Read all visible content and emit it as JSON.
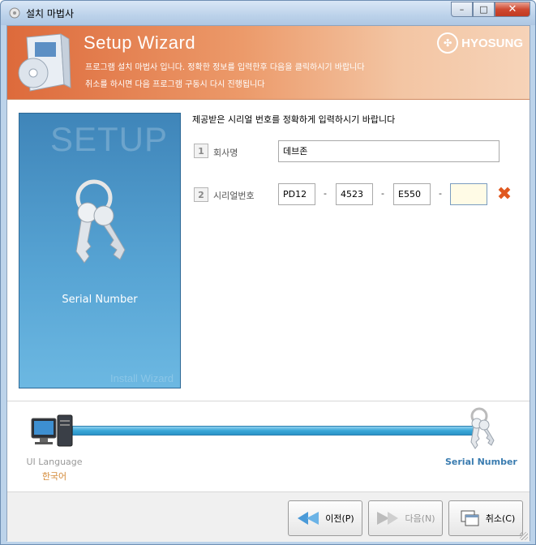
{
  "window": {
    "title": "설치 마법사",
    "minimize_label": "–",
    "maximize_label": "□",
    "close_label": "✕"
  },
  "banner": {
    "title": "Setup Wizard",
    "line1": "프로그램 설치 마법사 입니다. 정확한 정보를 입력한후 다음을 클릭하시기 바랍니다",
    "line2": "취소를 하시면 다음 프로그램 구동시 다시 진행됩니다",
    "brand": "HYOSUNG"
  },
  "left_panel": {
    "heading": "SETUP",
    "label": "Serial Number",
    "footer": "Install Wizard"
  },
  "form": {
    "instruction": "제공받은 시리얼 번호를 정확하게 입력하시기 바랍니다",
    "company": {
      "number": "1",
      "label": "회사명",
      "value": "데브존"
    },
    "serial": {
      "number": "2",
      "label": "시리얼번호",
      "parts": [
        "PD12",
        "4523",
        "E550",
        ""
      ],
      "separator": "-"
    }
  },
  "progress": {
    "start_label": "UI Language",
    "start_value": "한국어",
    "end_label": "Serial Number",
    "fraction": 1.0
  },
  "buttons": {
    "prev": "이전(P)",
    "next": "다음(N)",
    "cancel": "취소(C)"
  },
  "colors": {
    "banner_start": "#dd6a3b",
    "panel_blue": "#4a94c6",
    "accent_orange": "#d48b3a",
    "link_blue": "#3a7cb0"
  }
}
